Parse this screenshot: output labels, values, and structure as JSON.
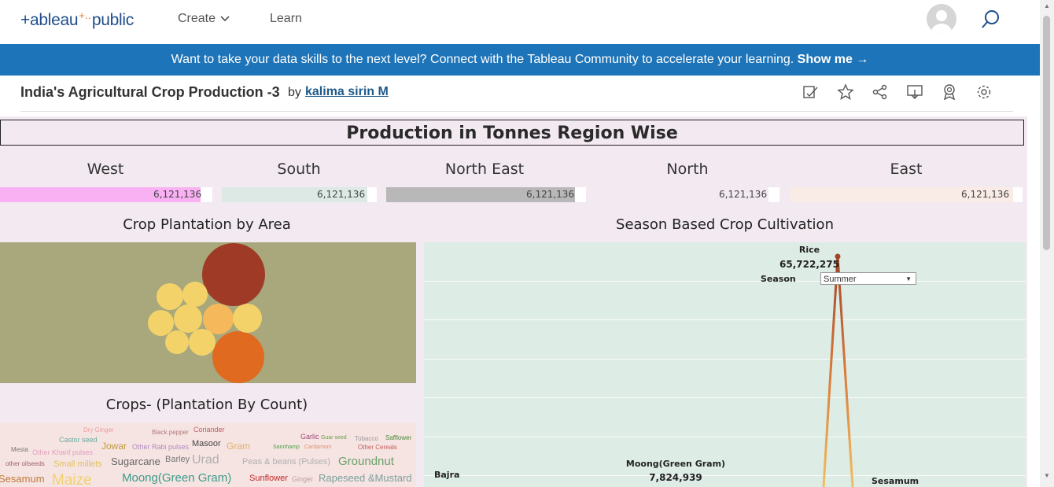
{
  "nav": {
    "logo_pre": "+ableau",
    "logo_plus": "+‥",
    "logo_post": "public",
    "create": "Create",
    "learn": "Learn"
  },
  "banner": {
    "text": "Want to take your data skills to the next level? Connect with the Tableau Community to accelerate your learning.",
    "cta": "Show me →"
  },
  "viz": {
    "title": "India's Agricultural Crop Production -3",
    "by": "by",
    "author": "kalima sirin M",
    "tools": [
      "edit-icon",
      "star-icon",
      "share-icon",
      "download-icon",
      "badge-icon",
      "settings-icon"
    ]
  },
  "dashboard": {
    "title": "Production in Tonnes Region Wise",
    "regions": [
      {
        "name": "West",
        "value": "6,121,136",
        "color": "#f9b1f4"
      },
      {
        "name": "South",
        "value": "6,121,136",
        "color": "#dde9e4"
      },
      {
        "name": "North East",
        "value": "6,121,136",
        "color": "#b8b8b8"
      },
      {
        "name": "North",
        "value": "6,121,136",
        "color": "#f2e9f1"
      },
      {
        "name": "East",
        "value": "6,121,136",
        "color": "#f9ece6"
      }
    ],
    "area_title": "Crop Plantation by Area",
    "count_title": "Crops- (Plantation By Count)",
    "season_title": "Season Based Crop Cultivation",
    "season_label": "Season",
    "season_value": "Summer",
    "marks": {
      "rice_name": "Rice",
      "rice_value": "65,722,275",
      "moong_name": "Moong(Green Gram)",
      "moong_value": "7,824,939",
      "bajra": "Bajra",
      "sesamum": "Sesamum"
    },
    "words": [
      "Dry Ginger",
      "Black pepper",
      "Coriander",
      "Garlic",
      "Guar seed",
      "Tobacco",
      "Safflower",
      "Castor seed",
      "Masoor",
      "Mesta",
      "Jowar",
      "Other Rabi pulses",
      "Gram",
      "Sannhamp",
      "Cardamom",
      "Other Cereals",
      "Other Kharif pulses",
      "other oilseeds",
      "Small millets",
      "Sugarcane",
      "Barley",
      "Urad",
      "Peas & beans (Pulses)",
      "Groundnut",
      "Sesamum",
      "Maize",
      "Moong(Green Gram)",
      "Sunflower",
      "Ginger",
      "Rapeseed &Mustard"
    ]
  }
}
